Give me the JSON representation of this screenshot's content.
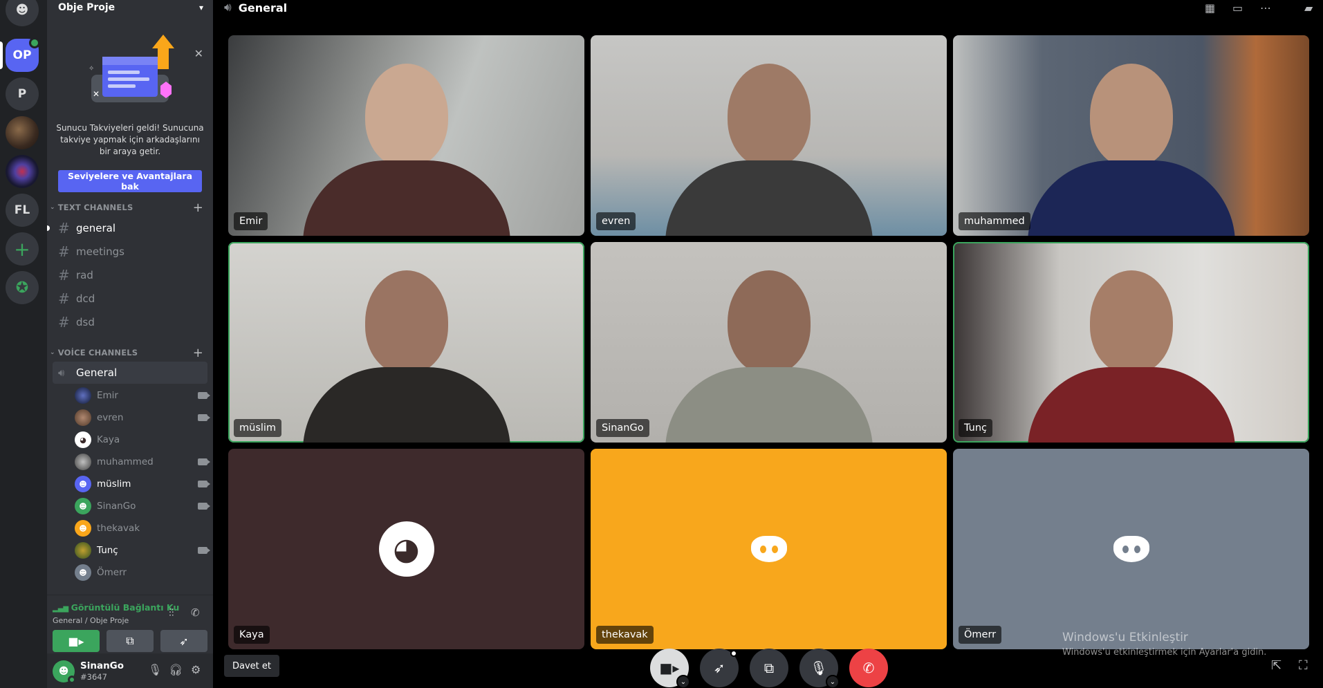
{
  "rail": {
    "servers": [
      "OP",
      "P",
      "FL"
    ]
  },
  "server": {
    "name": "Obje Proje"
  },
  "boost": {
    "text": "Sunucu Takviyeleri geldi! Sunucuna takviye yapmak için arkadaşlarını bir araya getir.",
    "button": "Seviyelere ve Avantajlara bak"
  },
  "categories": {
    "text": "TEXT CHANNELS",
    "voice": "VOİCE CHANNELS"
  },
  "text_channels": [
    "general",
    "meetings",
    "rad",
    "dcd",
    "dsd"
  ],
  "voice_channel": {
    "name": "General",
    "users": [
      "Emir",
      "evren",
      "Kaya",
      "muhammed",
      "müslim",
      "SinanGo",
      "thekavak",
      "Tunç",
      "Ömerr"
    ]
  },
  "voice_panel": {
    "status": "Görüntülü Bağlantı Ku",
    "location": "General / Obje Proje"
  },
  "user": {
    "name": "SinanGo",
    "tag": "#3647"
  },
  "tiles": [
    {
      "name": "Emir"
    },
    {
      "name": "evren"
    },
    {
      "name": "muhammed"
    },
    {
      "name": "müslim"
    },
    {
      "name": "SinanGo"
    },
    {
      "name": "Tunç"
    },
    {
      "name": "Kaya"
    },
    {
      "name": "thekavak"
    },
    {
      "name": "Ömerr"
    }
  ],
  "controls": {
    "invite": "Davet et"
  },
  "watermark": {
    "title": "Windows'u Etkinleştir",
    "subtitle": "Windows'u etkinleştirmek için Ayarlar'a gidin."
  },
  "colors": {
    "blurple": "#5865f2",
    "green": "#3ba55d",
    "red": "#ed4245",
    "orange": "#f8a71c",
    "grey": "#747f8d",
    "sidebar": "#2f3136",
    "rail": "#202225"
  }
}
